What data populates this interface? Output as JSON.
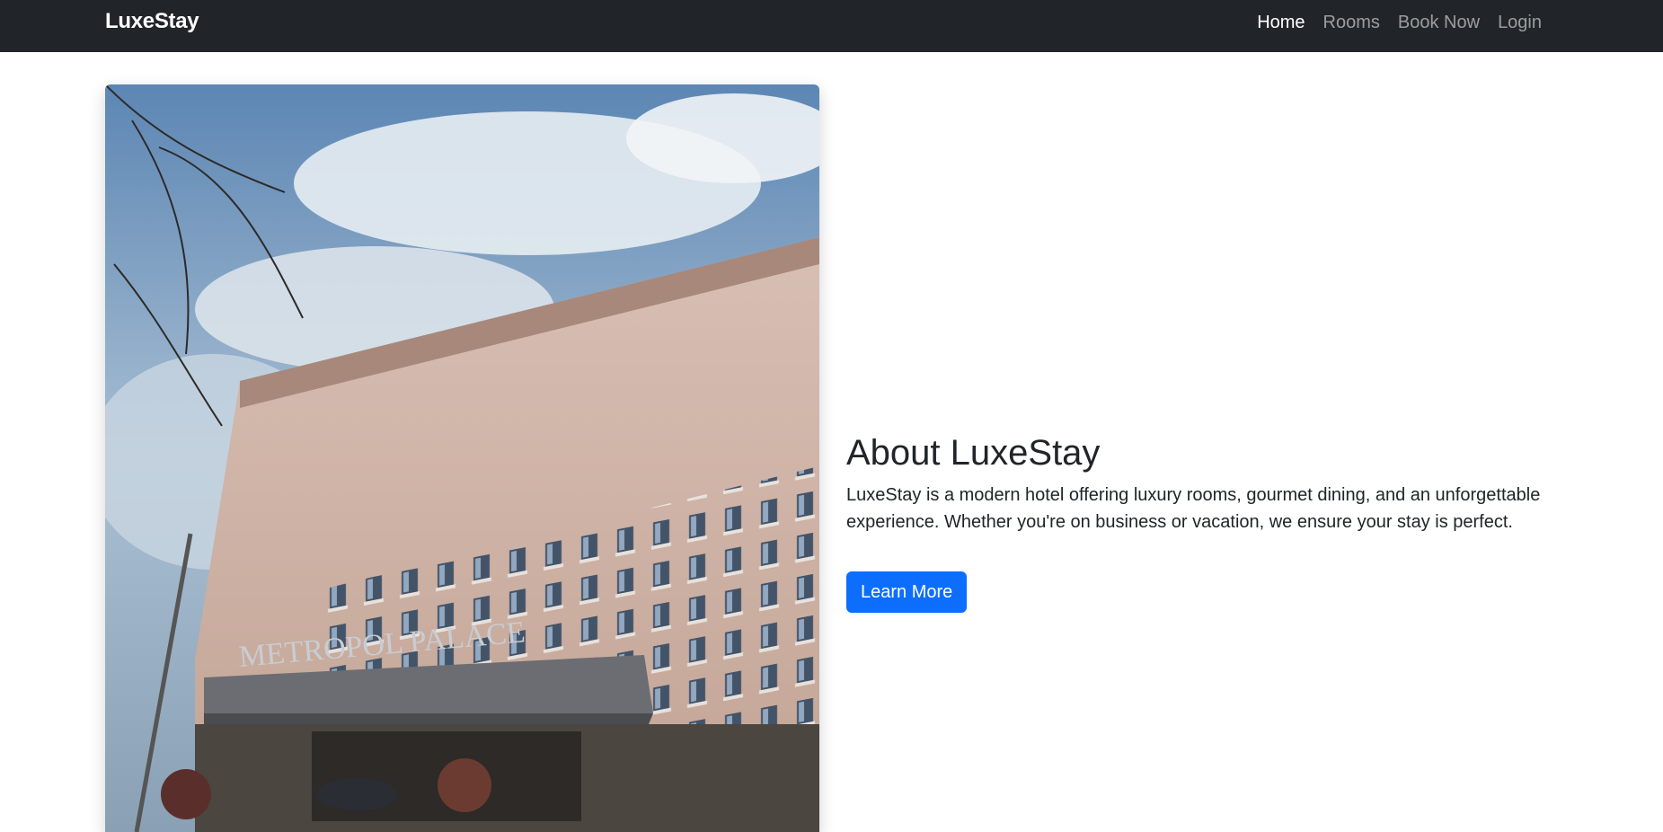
{
  "navbar": {
    "brand": "LuxeStay",
    "links": [
      {
        "label": "Home",
        "active": true
      },
      {
        "label": "Rooms",
        "active": false
      },
      {
        "label": "Book Now",
        "active": false
      },
      {
        "label": "Login",
        "active": false
      }
    ]
  },
  "hero": {
    "image_sign_text": "METROPOL PALACE"
  },
  "about": {
    "heading": "About LuxeStay",
    "body": "LuxeStay is a modern hotel offering luxury rooms, gourmet dining, and an unforgettable experience. Whether you're on business or vacation, we ensure your stay is perfect.",
    "button_label": "Learn More"
  },
  "colors": {
    "navbar_bg": "#212529",
    "primary": "#0d6efd",
    "text": "#212529"
  }
}
